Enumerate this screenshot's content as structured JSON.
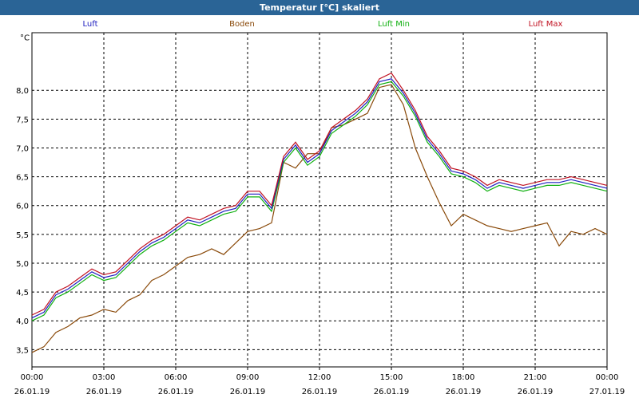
{
  "window": {
    "title": "Temperatur [°C] skaliert"
  },
  "colors": {
    "luft": "#2020c0",
    "boden": "#8a4a0a",
    "luft_min": "#10b010",
    "luft_max": "#c01020",
    "grid": "#000000",
    "titlebar": "#2a6496"
  },
  "chart_data": {
    "type": "line",
    "title": "Temperatur [°C] skaliert",
    "unit_label": "°C",
    "ylim": [
      3.2,
      9.0
    ],
    "yticks": [
      "3,5",
      "4,0",
      "4,5",
      "5,0",
      "5,5",
      "6,0",
      "6,5",
      "7,0",
      "7,5",
      "8,0"
    ],
    "ytick_values": [
      3.5,
      4.0,
      4.5,
      5.0,
      5.5,
      6.0,
      6.5,
      7.0,
      7.5,
      8.0
    ],
    "xlim_hours": [
      0,
      24
    ],
    "xticks": [
      {
        "time": "00:00",
        "date": "26.01.19"
      },
      {
        "time": "03:00",
        "date": "26.01.19"
      },
      {
        "time": "06:00",
        "date": "26.01.19"
      },
      {
        "time": "09:00",
        "date": "26.01.19"
      },
      {
        "time": "12:00",
        "date": "26.01.19"
      },
      {
        "time": "15:00",
        "date": "26.01.19"
      },
      {
        "time": "18:00",
        "date": "26.01.19"
      },
      {
        "time": "21:00",
        "date": "26.01.19"
      },
      {
        "time": "00:00",
        "date": "27.01.19"
      }
    ],
    "legend": [
      "Luft",
      "Boden",
      "Luft Min",
      "Luft Max"
    ],
    "x": [
      0,
      0.5,
      1,
      1.5,
      2,
      2.5,
      3,
      3.5,
      4,
      4.5,
      5,
      5.5,
      6,
      6.5,
      7,
      7.5,
      8,
      8.5,
      9,
      9.5,
      10,
      10.5,
      11,
      11.5,
      12,
      12.5,
      13,
      13.5,
      14,
      14.5,
      15,
      15.5,
      16,
      16.5,
      17,
      17.5,
      18,
      18.5,
      19,
      19.5,
      20,
      20.5,
      21,
      21.5,
      22,
      22.5,
      23,
      23.5,
      24
    ],
    "series": [
      {
        "name": "Luft",
        "values": [
          4.05,
          4.15,
          4.45,
          4.55,
          4.7,
          4.85,
          4.75,
          4.8,
          5.0,
          5.2,
          5.35,
          5.45,
          5.6,
          5.75,
          5.7,
          5.8,
          5.9,
          5.95,
          6.2,
          6.2,
          5.95,
          6.8,
          7.05,
          6.75,
          6.9,
          7.3,
          7.45,
          7.6,
          7.8,
          8.15,
          8.2,
          7.95,
          7.6,
          7.15,
          6.9,
          6.6,
          6.55,
          6.45,
          6.3,
          6.4,
          6.35,
          6.3,
          6.35,
          6.4,
          6.4,
          6.45,
          6.4,
          6.35,
          6.3
        ]
      },
      {
        "name": "Boden",
        "values": [
          3.45,
          3.55,
          3.8,
          3.9,
          4.05,
          4.1,
          4.2,
          4.15,
          4.35,
          4.45,
          4.7,
          4.8,
          4.95,
          5.1,
          5.15,
          5.25,
          5.15,
          5.35,
          5.55,
          5.6,
          5.7,
          6.75,
          6.65,
          6.9,
          6.9,
          7.35,
          7.4,
          7.5,
          7.6,
          8.05,
          8.1,
          7.75,
          7.0,
          6.5,
          6.05,
          5.65,
          5.85,
          5.75,
          5.65,
          5.6,
          5.55,
          5.6,
          5.65,
          5.7,
          5.3,
          5.55,
          5.5,
          5.6,
          5.5
        ]
      },
      {
        "name": "Luft Min",
        "values": [
          4.0,
          4.1,
          4.4,
          4.5,
          4.65,
          4.8,
          4.7,
          4.75,
          4.95,
          5.15,
          5.3,
          5.4,
          5.55,
          5.7,
          5.65,
          5.75,
          5.85,
          5.9,
          6.15,
          6.15,
          5.9,
          6.75,
          7.0,
          6.7,
          6.85,
          7.25,
          7.4,
          7.55,
          7.75,
          8.1,
          8.15,
          7.9,
          7.55,
          7.1,
          6.85,
          6.55,
          6.5,
          6.4,
          6.25,
          6.35,
          6.3,
          6.25,
          6.3,
          6.35,
          6.35,
          6.4,
          6.35,
          6.3,
          6.25
        ]
      },
      {
        "name": "Luft Max",
        "values": [
          4.1,
          4.2,
          4.5,
          4.6,
          4.75,
          4.9,
          4.8,
          4.85,
          5.05,
          5.25,
          5.4,
          5.5,
          5.65,
          5.8,
          5.75,
          5.85,
          5.95,
          6.0,
          6.25,
          6.25,
          6.0,
          6.85,
          7.1,
          6.8,
          6.95,
          7.35,
          7.5,
          7.65,
          7.85,
          8.2,
          8.3,
          8.0,
          7.65,
          7.2,
          6.95,
          6.65,
          6.6,
          6.5,
          6.35,
          6.45,
          6.4,
          6.35,
          6.4,
          6.45,
          6.45,
          6.5,
          6.45,
          6.4,
          6.35
        ]
      }
    ]
  }
}
